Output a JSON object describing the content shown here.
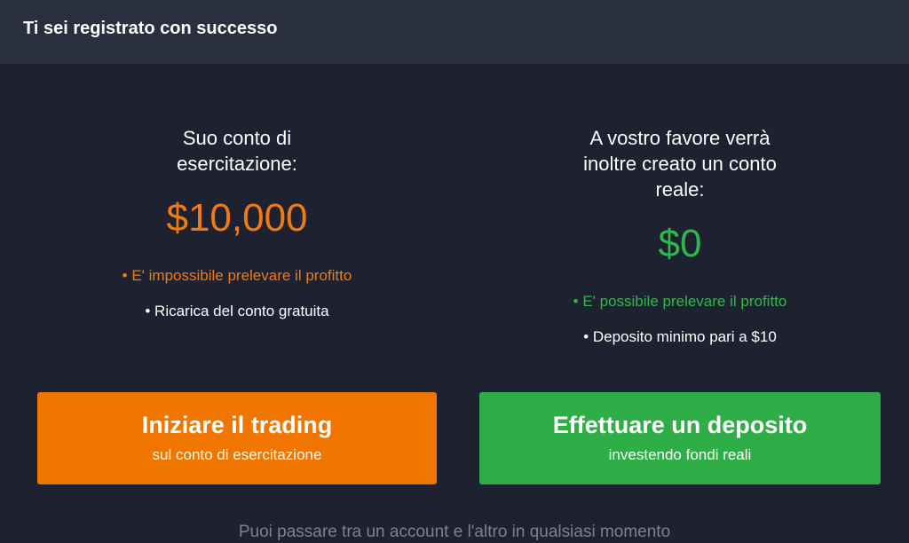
{
  "header": {
    "title": "Ti sei registrato con successo"
  },
  "practice": {
    "intro_line1": "Suo conto di",
    "intro_line2": "esercitazione:",
    "amount": "$10,000",
    "note_warning": "• E' impossibile prelevare il profitto",
    "note_info": "• Ricarica del conto gratuita"
  },
  "real": {
    "intro_line1": "A vostro favore verrà",
    "intro_line2": "inoltre creato un conto",
    "intro_line3": "reale:",
    "amount": "$0",
    "note_positive": "• E' possibile prelevare il profitto",
    "note_info": "• Deposito minimo pari a  $10"
  },
  "buttons": {
    "start_trading": {
      "title": "Iniziare il trading",
      "subtitle": "sul conto di esercitazione"
    },
    "deposit": {
      "title": "Effettuare un deposito",
      "subtitle": "investendo fondi reali"
    }
  },
  "footer": {
    "text": "Puoi passare tra un account e l'altro in qualsiasi momento"
  },
  "colors": {
    "background": "#1e2130",
    "header": "#2a2f3d",
    "orange": "#f07600",
    "green": "#2fae47"
  }
}
